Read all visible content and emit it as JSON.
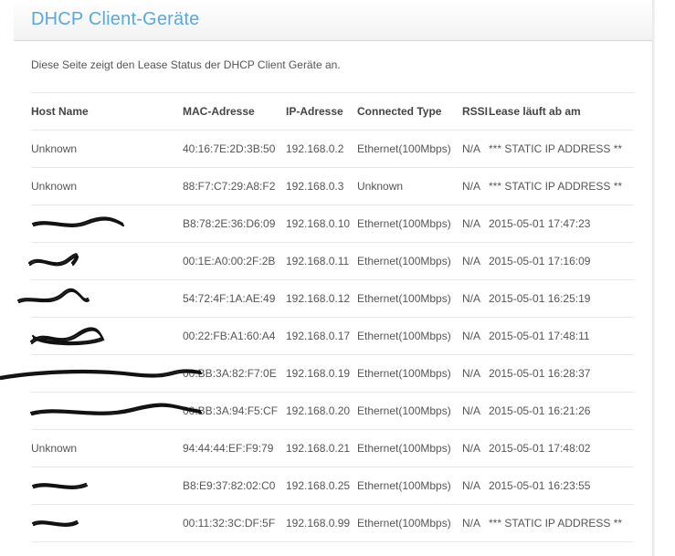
{
  "page": {
    "title": "DHCP Client-Geräte",
    "description": "Diese Seite zeigt den Lease Status der DHCP Client Geräte an."
  },
  "table": {
    "headers": [
      "Host Name",
      "MAC-Adresse",
      "IP-Adresse",
      "Connected Type",
      "RSSI",
      "Lease läuft ab am"
    ],
    "rows": [
      {
        "host": "Unknown",
        "mac": "40:16:7E:2D:3B:50",
        "ip": "192.168.0.2",
        "type": "Ethernet(100Mbps)",
        "rssi": "N/A",
        "lease": "*** STATIC IP ADDRESS **"
      },
      {
        "host": "Unknown",
        "mac": "88:F7:C7:29:A8:F2",
        "ip": "192.168.0.3",
        "type": "Unknown",
        "rssi": "N/A",
        "lease": "*** STATIC IP ADDRESS **"
      },
      {
        "host": "",
        "mac": "B8:78:2E:36:D6:09",
        "ip": "192.168.0.10",
        "type": "Ethernet(100Mbps)",
        "rssi": "N/A",
        "lease": "2015-05-01 17:47:23"
      },
      {
        "host": "",
        "mac": "00:1E:A0:00:2F:2B",
        "ip": "192.168.0.11",
        "type": "Ethernet(100Mbps)",
        "rssi": "N/A",
        "lease": "2015-05-01 17:16:09"
      },
      {
        "host": "",
        "mac": "54:72:4F:1A:AE:49",
        "ip": "192.168.0.12",
        "type": "Ethernet(100Mbps)",
        "rssi": "N/A",
        "lease": "2015-05-01 16:25:19"
      },
      {
        "host": "",
        "mac": "00:22:FB:A1:60:A4",
        "ip": "192.168.0.17",
        "type": "Ethernet(100Mbps)",
        "rssi": "N/A",
        "lease": "2015-05-01 17:48:11"
      },
      {
        "host": "",
        "mac": "00:BB:3A:82:F7:0E",
        "ip": "192.168.0.19",
        "type": "Ethernet(100Mbps)",
        "rssi": "N/A",
        "lease": "2015-05-01 16:28:37"
      },
      {
        "host": "",
        "mac": "00:BB:3A:94:F5:CF",
        "ip": "192.168.0.20",
        "type": "Ethernet(100Mbps)",
        "rssi": "N/A",
        "lease": "2015-05-01 16:21:26"
      },
      {
        "host": "Unknown",
        "mac": "94:44:44:EF:F9:79",
        "ip": "192.168.0.21",
        "type": "Ethernet(100Mbps)",
        "rssi": "N/A",
        "lease": "2015-05-01 17:48:02"
      },
      {
        "host": "",
        "mac": "B8:E9:37:82:02:C0",
        "ip": "192.168.0.25",
        "type": "Ethernet(100Mbps)",
        "rssi": "N/A",
        "lease": "2015-05-01 16:23:55"
      },
      {
        "host": "",
        "mac": "00:11:32:3C:DF:5F",
        "ip": "192.168.0.99",
        "type": "Ethernet(100Mbps)",
        "rssi": "N/A",
        "lease": "*** STATIC IP ADDRESS **"
      }
    ]
  },
  "colors": {
    "title": "#5aa9dc",
    "text": "#555555",
    "divider": "#e7e7e7",
    "redaction": "#111111"
  }
}
